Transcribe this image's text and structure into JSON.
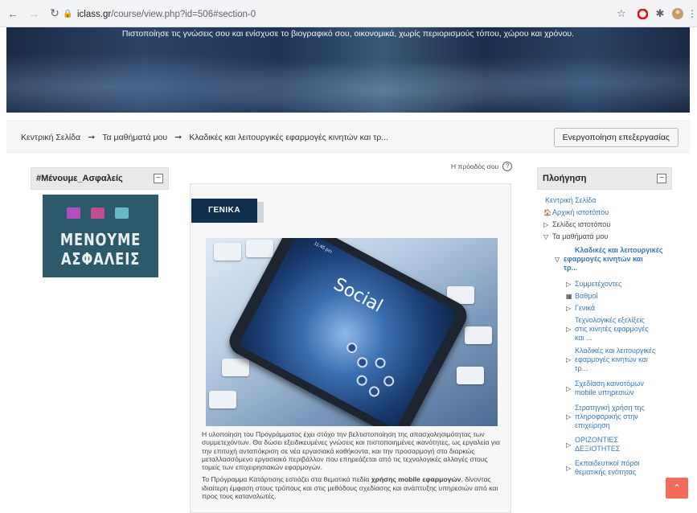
{
  "browser": {
    "url_host": "iclass.gr",
    "url_path": "/course/view.php?id=506#section-0"
  },
  "banner": {
    "tagline": "Πιστοποίησε τις γνώσεις σου και ενίσχυσε το βιογραφικό σου, οικονομικά, χωρίς περιορισμούς τόπου, χώρου και χρόνου."
  },
  "breadcrumb": {
    "items": [
      "Κεντρική Σελίδα",
      "Τα μαθήματά μου",
      "Κλαδικές και λειτουργικές εφαρμογές κινητών και τρ..."
    ],
    "separator": "➞",
    "edit_button": "Ενεργοποίηση επεξεργασίας"
  },
  "left_block": {
    "title": "#Μένουμε_Ασφαλείς",
    "tile_line1": "ΜΕΝΟΥΜΕ",
    "tile_line2": "ΑΣΦΑΛΕΙΣ",
    "icon_colors": [
      "#b24fbf",
      "#c24d8e",
      "#6bb6c9"
    ]
  },
  "progress": {
    "label": "Η πρόοδός σου"
  },
  "section": {
    "tab_label": "ΓΕΝΙΚΑ",
    "image_text": "Social",
    "image_time": "11:45 pm",
    "paragraph1": "Η υλοποίηση του Προγράμματος έχει στόχο την βελτιστοποίηση της απασχολησιμότητας των συμμετεχόντων. Θα δώσει εξειδικευμένες γνώσεις και πιστοποιημένες ικανότητες, ως εργαλεία για την επιτυχή ανταπόκριση σε νέα εργασιακά καθήκοντα, και την προσαρμογή στο διαρκώς μεταλλασσόμενο εργασιακό περιβάλλον που επηρεάζεται από τις τεχνολογικές αλλαγές στους τομείς των επιχειρησιακών εφαρμογών.",
    "paragraph2_prefix": "Το Πρόγραμμα Κατάρτισης εστιάζει στα θεματικά πεδία ",
    "paragraph2_bold": "χρήσης mobile εφαρμογών",
    "paragraph2_suffix": ", δίνοντας ιδιαίτερη έμφαση στους τρόπους και στις μεθόδους σχεδίασης και ανάπτυξης υπηρεσιών από και προς τους καταναλωτές."
  },
  "navigation": {
    "title": "Πλοήγηση",
    "home": "Κεντρική Σελίδα",
    "site_home": "Αρχική ιστοτόπου",
    "site_pages": "Σελίδες ιστοτόπου",
    "my_courses": "Τα μαθήματά μου",
    "course_l1": "Κλαδικές και λειτουργικές",
    "course_l2": "εφαρμογές κινητών και",
    "course_l3": "τρ...",
    "participants": "Συμμετέχοντες",
    "grades": "Βαθμοί",
    "general": "Γενικά",
    "topic1_l1": "Τεχνολογικές εξελίξεις",
    "topic1_l2": "στις κινητές εφαρμογές",
    "topic1_l3": "και ...",
    "topic2_l1": "Κλαδικές και λειτουργικές",
    "topic2_l2": "εφαρμογές κινητών και",
    "topic2_l3": "τρ...",
    "topic3_l1": "Σχεδίαση καινοτόμων",
    "topic3_l2": "mobile υπηρεσιών",
    "topic4_l1": "Στρατηγική χρήση της",
    "topic4_l2": "πληροφορικής στην",
    "topic4_l3": "επιχείρηση",
    "topic5_l1": "ΟΡΙΖΟΝΤΙΕΣ",
    "topic5_l2": "ΔΕΞΙΟΤΗΤΕΣ",
    "topic6_l1": "Εκπαιδευτικοί πόροι",
    "topic6_l2": "θεματικής ενότητας"
  },
  "colors": {
    "link": "#3a77b8",
    "section_tab": "#0f2f4f",
    "back_to_top": "#f36b5c"
  }
}
